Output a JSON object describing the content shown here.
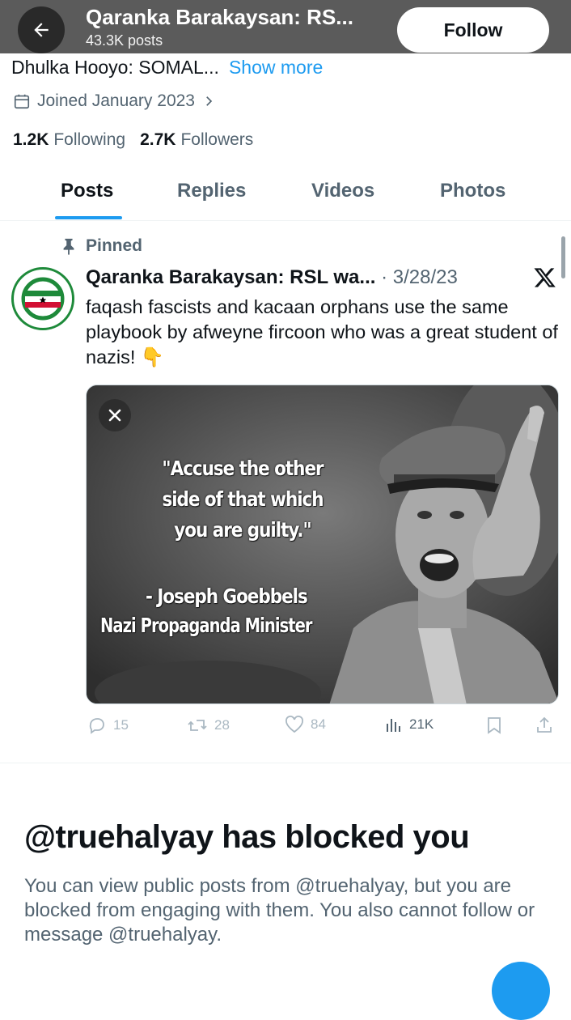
{
  "header": {
    "title": "Qaranka Barakaysan: RS...",
    "post_count": "43.3K posts",
    "follow_label": "Follow"
  },
  "profile": {
    "bio": "Dhulka Hooyo: SOMAL...",
    "show_more": "Show more",
    "joined": "Joined January 2023",
    "following_count": "1.2K",
    "following_label": "Following",
    "followers_count": "2.7K",
    "followers_label": "Followers"
  },
  "tabs": [
    "Posts",
    "Replies",
    "Videos",
    "Photos"
  ],
  "tweet": {
    "pinned_label": "Pinned",
    "author": "Qaranka Barakaysan: RSL wa...",
    "date": "· 3/28/23",
    "text": "faqash fascists and kacaan orphans use the same playbook by afweyne fircoon who was a great student of nazis! 👇",
    "media_quote": "\"Accuse the other side of that which you are guilty.\"",
    "media_attribution_1": "- Joseph Goebbels",
    "media_attribution_2": "Nazi Propaganda Minister",
    "replies": "15",
    "reposts": "28",
    "likes": "84",
    "views": "21K"
  },
  "blocked": {
    "title": "@truehalyay has blocked you",
    "body": "You can view public posts from @truehalyay, but you are blocked from engaging with them. You also cannot follow or message @truehalyay."
  },
  "colors": {
    "accent": "#1d9bf0",
    "text_primary": "#0f1419",
    "text_secondary": "#536471",
    "header_bg": "#5b5b5b"
  },
  "icons": [
    "back-arrow-icon",
    "calendar-icon",
    "chevron-right-icon",
    "pin-icon",
    "x-logo-icon",
    "close-icon",
    "reply-icon",
    "repost-icon",
    "like-icon",
    "views-icon",
    "bookmark-icon",
    "share-icon"
  ]
}
